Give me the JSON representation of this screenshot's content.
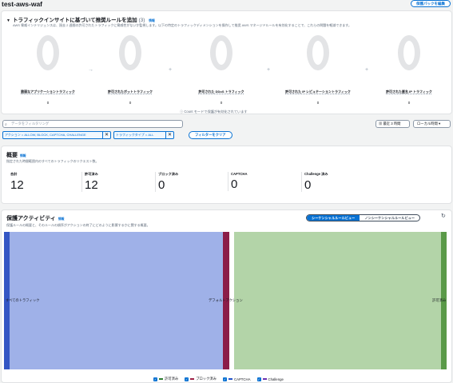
{
  "header": {
    "title": "test-aws-waf",
    "edit_button": "保護パックを編集"
  },
  "insights": {
    "title": "トラフィックインサイトに基づいて推奨ルールを追加",
    "count": "(3)",
    "info": "情報",
    "description": "AWS 脅威インテリジェンスは、過去 2 週間の許可されたトラフィックに脅威性がないか監視します。以下の特定のトラフィックディメンションを操作して推奨 AWS マネージドルールを有効化することで、これらの問題を軽減できます。",
    "items": [
      {
        "label": "脆弱なアプリケーショントラフィック",
        "value": "0"
      },
      {
        "label": "許可されたボットトラフィック",
        "value": "0"
      },
      {
        "label": "許可された DDoS トラフィック",
        "value": "0"
      },
      {
        "label": "許可された IP レピュテーショントラフィック",
        "value": "0"
      },
      {
        "label": "許可された匿名 IP トラフィック",
        "value": "0"
      }
    ],
    "count_note": "Count モードで保護が有効化されています"
  },
  "filters": {
    "search_placeholder": "データをフィルタリング",
    "chips": [
      "アクション = ALLOW, BLOCK, CAPTCHA, CHALLENGE",
      "トラフィックタイプ = ALL"
    ],
    "clear_button": "フィルターをクリア",
    "range": "最近 3 時間",
    "timezone": "ローカル時間"
  },
  "overview": {
    "title": "概要",
    "info": "情報",
    "description": "指定された時間範囲内のすべてのトラフィックのリクエスト数。",
    "metrics": [
      {
        "label": "合計",
        "value": "12"
      },
      {
        "label": "許可済み",
        "value": "12"
      },
      {
        "label": "ブロック済み",
        "value": "0"
      },
      {
        "label": "CAPTCHA",
        "value": "0"
      },
      {
        "label": "Challenge 済み",
        "value": "0"
      }
    ]
  },
  "activity": {
    "title": "保護アクティビティ",
    "info": "情報",
    "description": "保護ルールの概要と、そのルールの順序がアクションの終了にどのように影響するかに関する概要。",
    "seg_on": "シーケンシャルルールビュー",
    "seg_off": "ノンシーケンシャルルールビュー",
    "nodes": [
      "すべてのトラフィック",
      "デフォルトアクション",
      "許可済み"
    ],
    "legend": [
      "許可済み",
      "ブロック済み",
      "CAPTCHA",
      "Challenge"
    ],
    "colors": {
      "flow_left": "#9fb1e8",
      "flow_right": "#b3d4a8",
      "node_all": "#3456c4",
      "node_default": "#8b1d48",
      "node_allowed": "#5a9a48",
      "legend_allowed": "#2e7d32",
      "legend_blocked": "#9e2146",
      "legend_captcha": "#2453c8",
      "legend_challenge": "#6a2fb0"
    }
  }
}
